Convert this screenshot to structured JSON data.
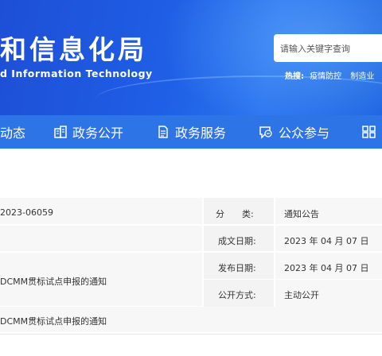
{
  "header": {
    "title_cn": "和信息化局",
    "title_en": "d Information Technology",
    "search_placeholder": "请输入关键字查询",
    "hot_label": "热搜:",
    "hot_items": [
      "疫情防控",
      "制造业"
    ]
  },
  "nav": {
    "items": [
      {
        "label": "动态",
        "icon": "none"
      },
      {
        "label": "政务公开",
        "icon": "building-icon"
      },
      {
        "label": "政务服务",
        "icon": "document-icon"
      },
      {
        "label": "公众参与",
        "icon": "chat-icon"
      },
      {
        "label": "",
        "icon": "grid-icon"
      }
    ]
  },
  "info": {
    "doc_number": "2023-06059",
    "category_label": "分　　类:",
    "category_value": "通知公告",
    "created_label": "成文日期:",
    "created_value": "2023 年 04 月 07 日",
    "published_label": "发布日期:",
    "published_value": "2023 年 04 月 07 日",
    "title_partial": "DCMM贯标试点申报的通知",
    "open_label": "公开方式:",
    "open_value": "主动公开",
    "subject_partial": "DCMM贯标试点申报的通知"
  },
  "colors": {
    "header_blue": "#1f5fe6",
    "nav_blue": "#2d74e6",
    "row_bg": "#f7f7f8"
  }
}
